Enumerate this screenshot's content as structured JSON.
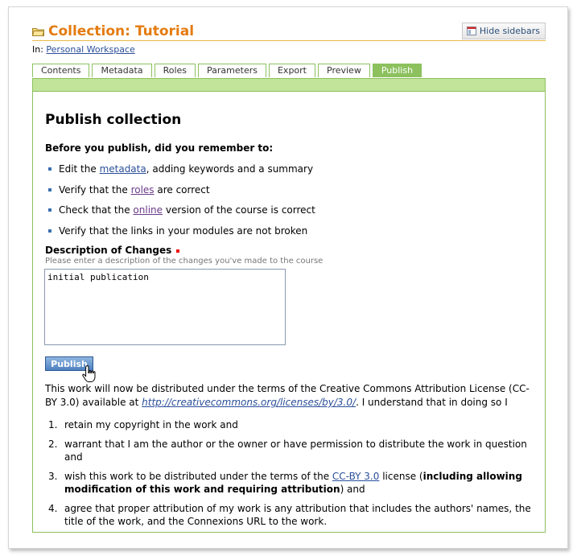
{
  "header": {
    "title": "Collection: Tutorial",
    "hide_sidebars": "Hide sidebars"
  },
  "location": {
    "prefix": "In:",
    "link": "Personal Workspace"
  },
  "tabs": [
    {
      "label": "Contents"
    },
    {
      "label": "Metadata"
    },
    {
      "label": "Roles"
    },
    {
      "label": "Parameters"
    },
    {
      "label": "Export"
    },
    {
      "label": "Preview"
    },
    {
      "label": "Publish",
      "active": true
    }
  ],
  "main": {
    "heading": "Publish collection",
    "checklist_intro": "Before you publish, did you remember to:",
    "checklist": [
      {
        "before": "Edit the ",
        "link": "metadata",
        "after": ", adding keywords and a summary"
      },
      {
        "before": "Verify that the ",
        "link": "roles",
        "after": " are correct"
      },
      {
        "before": "Check that the ",
        "link": "online",
        "after": " version of the course is correct"
      },
      {
        "before": "Verify that the links in your modules are not broken",
        "link": "",
        "after": ""
      }
    ],
    "description_label": "Description of Changes",
    "description_help": "Please enter a description of the changes you've made to the course",
    "description_value": "initial publication",
    "publish_button": "Publish",
    "terms_text_1": "This work will now be distributed under the terms of the Creative Commons Attribution License (CC-BY 3.0) available at ",
    "terms_link": "http://creativecommons.org/licenses/by/3.0/",
    "terms_text_2": ". I understand that in doing so I",
    "items": [
      {
        "num": "1.",
        "text": "retain my copyright in the work and"
      },
      {
        "num": "2.",
        "text": "warrant that I am the author or the owner or have permission to distribute the work in question and"
      },
      {
        "num": "3.",
        "before": "wish this work to be distributed under the terms of the ",
        "link": "CC-BY 3.0",
        "middle": " license (",
        "bold": "including allowing modification of this work and requiring attribution",
        "after": ") and"
      },
      {
        "num": "4.",
        "text": "agree that proper attribution of my work is any attribution that includes the authors' names, the title of the work, and the Connexions URL to the work."
      }
    ]
  },
  "colors": {
    "title": "#e47b10",
    "tab_green": "#8cc15e",
    "tabbar": "#c2e49a"
  },
  "icons": [
    "folder-icon",
    "hide-sidebars-icon",
    "hand-cursor-icon"
  ]
}
